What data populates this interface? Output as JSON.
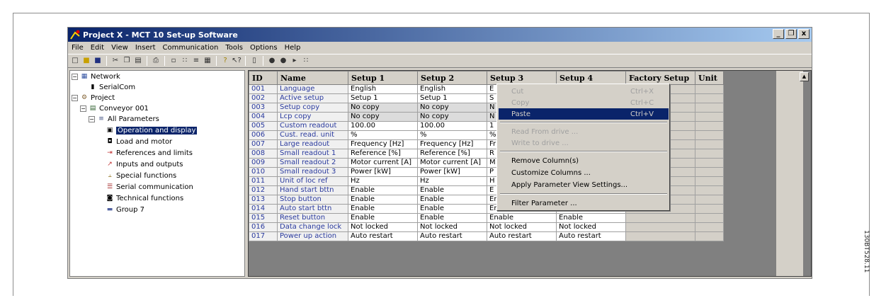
{
  "window": {
    "title": "Project X - MCT 10 Set-up Software",
    "caption_buttons": [
      "_",
      "Ő",
      "x"
    ]
  },
  "menu": [
    "File",
    "Edit",
    "View",
    "Insert",
    "Communication",
    "Tools",
    "Options",
    "Help"
  ],
  "tree": {
    "network": "Network",
    "serialcom": "SerialCom",
    "project": "Project",
    "conveyor": "Conveyor 001",
    "all_params": "All Parameters",
    "groups": [
      "Operation and display",
      "Load and motor",
      "References and limits",
      "Inputs and outputs",
      "Special functions",
      "Serial communication",
      "Technical functions",
      "Group 7"
    ]
  },
  "grid": {
    "headers": [
      "ID",
      "Name",
      "Setup 1",
      "Setup 2",
      "Setup 3",
      "Setup 4",
      "Factory Setup",
      "Unit"
    ],
    "rows": [
      [
        "001",
        "Language",
        "English",
        "English",
        "E",
        "",
        "",
        ""
      ],
      [
        "002",
        "Active setup",
        "Setup 1",
        "Setup 1",
        "S",
        "",
        "",
        ""
      ],
      [
        "003",
        "Setup copy",
        "No copy",
        "No copy",
        "N",
        "",
        "",
        ""
      ],
      [
        "004",
        "Lcp copy",
        "No copy",
        "No copy",
        "N",
        "",
        "",
        ""
      ],
      [
        "005",
        "Custom readout",
        "100.00",
        "100.00",
        "1",
        "",
        "",
        ""
      ],
      [
        "006",
        "Cust. read. unit",
        "%",
        "%",
        "%",
        "",
        "",
        ""
      ],
      [
        "007",
        "Large readout",
        "Frequency [Hz]",
        "Frequency [Hz]",
        "Fr",
        "",
        "",
        ""
      ],
      [
        "008",
        "Small readout 1",
        "Reference [%]",
        "Reference [%]",
        "R",
        "",
        "",
        ""
      ],
      [
        "009",
        "Small readout 2",
        "Motor current [A]",
        "Motor current [A]",
        "M",
        "",
        "",
        ""
      ],
      [
        "010",
        "Small readout 3",
        "Power [kW]",
        "Power [kW]",
        "P",
        "",
        "",
        ""
      ],
      [
        "011",
        "Unit of loc ref",
        "Hz",
        "Hz",
        "H",
        "",
        "",
        ""
      ],
      [
        "012",
        "Hand start bttn",
        "Enable",
        "Enable",
        "E",
        "",
        "",
        ""
      ],
      [
        "013",
        "Stop button",
        "Enable",
        "Enable",
        "Enable",
        "Enable",
        "",
        ""
      ],
      [
        "014",
        "Auto start bttn",
        "Enable",
        "Enable",
        "Enable",
        "Enable",
        "",
        ""
      ],
      [
        "015",
        "Reset button",
        "Enable",
        "Enable",
        "Enable",
        "Enable",
        "",
        ""
      ],
      [
        "016",
        "Data change lock",
        "Not locked",
        "Not locked",
        "Not locked",
        "Not locked",
        "",
        ""
      ],
      [
        "017",
        "Power up action",
        "Auto restart",
        "Auto restart",
        "Auto restart",
        "Auto restart",
        "",
        ""
      ]
    ]
  },
  "context_menu": {
    "cut": "Cut",
    "cut_sc": "Ctrl+X",
    "copy": "Copy",
    "copy_sc": "Ctrl+C",
    "paste": "Paste",
    "paste_sc": "Ctrl+V",
    "read": "Read From drive ...",
    "write": "Write to drive ...",
    "remove": "Remove Column(s)",
    "customize": "Customize Columns ...",
    "apply": "Apply Parameter View Settings...",
    "filter": "Filter Parameter ..."
  },
  "side_code": "130BT528.11"
}
